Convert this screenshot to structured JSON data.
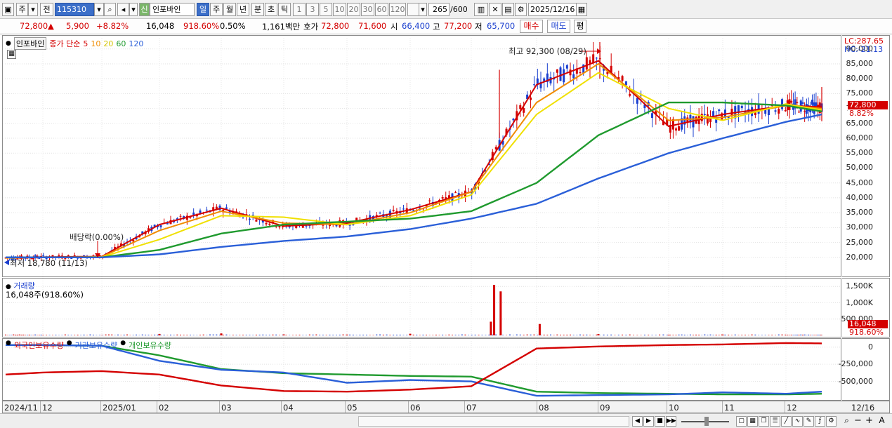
{
  "toolbar": {
    "left_tabs": [
      "주",
      "전"
    ],
    "code": "115310",
    "market_badge": "신",
    "stock_name": "인포바인",
    "periods": [
      "일",
      "주",
      "월",
      "년",
      "분",
      "초",
      "틱"
    ],
    "intervals": [
      "1",
      "3",
      "5",
      "10",
      "20",
      "30",
      "60",
      "120"
    ],
    "count": "265",
    "count_total": "/600",
    "date": "2025/12/16"
  },
  "quote": {
    "price": "72,800",
    "change_arrow": "▲",
    "change": "5,900",
    "change_pct": "+8.82%",
    "volume": "16,048",
    "volume_pct": "918.60%",
    "turnover": "0.50%",
    "amount": "1,161백만",
    "ask_label": "호가",
    "ask1": "72,800",
    "ask2": "71,600",
    "open_label": "시",
    "open": "66,400",
    "high_label": "고",
    "high": "77,200",
    "low_label": "저",
    "low": "65,700",
    "buy": "매수",
    "sell": "매도",
    "avg": "평"
  },
  "price_pane": {
    "name_tag": "인포바인",
    "legend_prefix": "종가 단순",
    "ma_legend": [
      {
        "label": "5",
        "color": "#d40000"
      },
      {
        "label": "10",
        "color": "#f08c00"
      },
      {
        "label": "20",
        "color": "#e8d800"
      },
      {
        "label": "60",
        "color": "#1f9a2e"
      },
      {
        "label": "120",
        "color": "#2a5fd8"
      }
    ],
    "lc": "LC:287.65",
    "hc": "HC:-21.13",
    "annotations": {
      "high": "최고 92,300 (08/29)",
      "dividend": "배당락(0.00%)",
      "low": "최저 18,780 (11/13)"
    },
    "price_tag": "72,800",
    "pct_tag": "8.82%",
    "yticks": [
      "90,000",
      "85,000",
      "80,000",
      "75,000",
      "70,000",
      "65,000",
      "60,000",
      "55,000",
      "50,000",
      "45,000",
      "40,000",
      "35,000",
      "30,000",
      "25,000",
      "20,000"
    ]
  },
  "volume_pane": {
    "title": "거래량",
    "value": "16,048주(918.60%)",
    "yticks": [
      "1,500K",
      "1,000K",
      "500,000"
    ],
    "tag": "16,048",
    "tag_pct": "918.60%"
  },
  "holdings_pane": {
    "legend": [
      {
        "label": "외국인보유수량",
        "color": "#d40000"
      },
      {
        "label": "기관보유수량",
        "color": "#2a5fd8"
      },
      {
        "label": "개인보유수량",
        "color": "#1f9a2e"
      }
    ],
    "yticks": [
      "0",
      "-250,000",
      "-500,000"
    ]
  },
  "xaxis": {
    "labels": [
      "2024/11",
      "12",
      "2025/01",
      "02",
      "03",
      "04",
      "05",
      "06",
      "07",
      "08",
      "09",
      "10",
      "11",
      "12"
    ],
    "end_label": "12/16"
  },
  "colors": {
    "up": "#d40000",
    "down": "#1a3fcf",
    "ma5": "#d40000",
    "ma10": "#f08c00",
    "ma20": "#f0e000",
    "ma60": "#1f9a2e",
    "ma120": "#2a5fd8"
  },
  "chart_data": [
    {
      "type": "line",
      "title": "인포바인 일봉 (종가 단순 이동평균 5·10·20·60·120)",
      "x": [
        "2024/11",
        "12",
        "2025/01",
        "02",
        "03",
        "04",
        "05",
        "06",
        "07",
        "08",
        "09",
        "10",
        "11",
        "12",
        "12/16"
      ],
      "series": [
        {
          "name": "5",
          "values": [
            19800,
            20100,
            20300,
            31000,
            36500,
            30500,
            31500,
            36000,
            42000,
            78000,
            86000,
            64000,
            68000,
            71000,
            70500
          ]
        },
        {
          "name": "10",
          "values": [
            19800,
            20000,
            20200,
            29000,
            35500,
            31500,
            31000,
            35000,
            42000,
            72000,
            85000,
            66000,
            67000,
            71000,
            70000
          ]
        },
        {
          "name": "20",
          "values": [
            19900,
            20000,
            20100,
            26000,
            34000,
            33500,
            31000,
            34000,
            41000,
            68000,
            82000,
            70000,
            66000,
            71500,
            69500
          ]
        },
        {
          "name": "60",
          "values": [
            20000,
            20000,
            20000,
            22500,
            28000,
            31000,
            32000,
            33000,
            35500,
            45000,
            61000,
            72000,
            72000,
            71000,
            69000
          ]
        },
        {
          "name": "120",
          "values": [
            20000,
            20000,
            20000,
            21000,
            23500,
            25500,
            27000,
            29500,
            33000,
            38000,
            46500,
            55000,
            60000,
            65500,
            68000
          ]
        }
      ],
      "ylim": [
        15000,
        93000
      ],
      "high": {
        "label": "최고",
        "value": 92300,
        "date": "08/29"
      },
      "low": {
        "label": "최저",
        "value": 18780,
        "date": "11/13"
      },
      "last": {
        "close": 72800,
        "change_pct": 8.82
      }
    },
    {
      "type": "bar",
      "title": "거래량",
      "categories": [
        "2024/11",
        "12",
        "2025/01",
        "02",
        "03",
        "04",
        "05",
        "06",
        "07a",
        "07b",
        "07c",
        "08",
        "09",
        "10",
        "11",
        "12"
      ],
      "values": [
        5000,
        6000,
        8000,
        45000,
        60000,
        30000,
        25000,
        50000,
        420000,
        1550000,
        1350000,
        350000,
        40000,
        20000,
        25000,
        16048
      ],
      "ylim": [
        0,
        1700000
      ]
    },
    {
      "type": "line",
      "title": "보유수량",
      "x": [
        "2024/11",
        "12",
        "2025/01",
        "02",
        "03",
        "04",
        "05",
        "06",
        "07",
        "08",
        "09",
        "10",
        "11",
        "12",
        "12/16"
      ],
      "series": [
        {
          "name": "외국인보유수량",
          "values": [
            -400000,
            -370000,
            -350000,
            -400000,
            -560000,
            -640000,
            -650000,
            -620000,
            -570000,
            -20000,
            10000,
            30000,
            40000,
            60000,
            55000
          ]
        },
        {
          "name": "기관보유수량",
          "values": [
            30000,
            30000,
            20000,
            -200000,
            -330000,
            -370000,
            -520000,
            -480000,
            -500000,
            -710000,
            -700000,
            -690000,
            -660000,
            -680000,
            -650000
          ]
        },
        {
          "name": "개인보유수량",
          "values": [
            30000,
            30000,
            20000,
            -120000,
            -320000,
            -380000,
            -400000,
            -420000,
            -430000,
            -650000,
            -670000,
            -680000,
            -690000,
            -690000,
            -680000
          ]
        }
      ],
      "ylim": [
        -750000,
        100000
      ]
    }
  ]
}
